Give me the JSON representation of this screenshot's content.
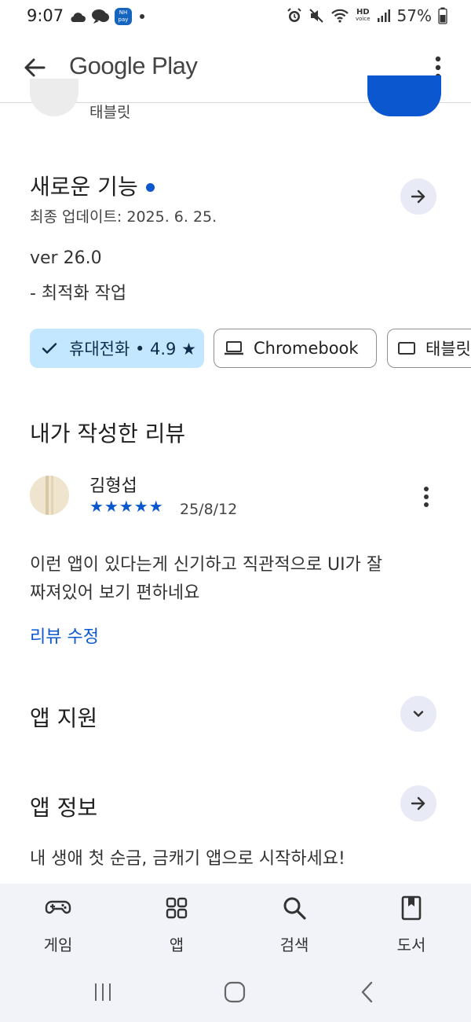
{
  "status_bar": {
    "time": "9:07",
    "left_icons": [
      "cloud-icon",
      "chat-bubble-icon",
      "nh-pay-icon",
      "dot-icon"
    ],
    "nh_pay_text": "NH pay",
    "right_icons": [
      "alarm-icon",
      "mute-icon",
      "wifi-icon",
      "hd-voice-icon",
      "signal-icon",
      "battery-icon"
    ],
    "hd_label": "HD",
    "voice_label": "voice",
    "battery": "57%"
  },
  "app_bar": {
    "title": "Google Play",
    "back_icon": "arrow-back-icon",
    "menu_icon": "more-vert-icon"
  },
  "partial_header": {
    "subtitle": "태블릿"
  },
  "whats_new": {
    "title": "새로운 기능",
    "last_updated": "최종 업데이트: 2025. 6. 25.",
    "version": "ver 26.0",
    "notes": "- 최적화 작업"
  },
  "device_chips": [
    {
      "label": "휴대전화 • 4.9 ★",
      "selected": true,
      "icon": "check-icon"
    },
    {
      "label": "Chromebook",
      "selected": false,
      "icon": "laptop-icon"
    },
    {
      "label": "태블릿",
      "selected": false,
      "icon": "tablet-icon"
    }
  ],
  "my_review": {
    "section_title": "내가 작성한 리뷰",
    "author": "김형섭",
    "rating": 5,
    "stars": "★★★★★",
    "date": "25/8/12",
    "text_line1": "이런 앱이 있다는게 신기하고 직관적으로 UI가 잘",
    "text_line2": "짜져있어 보기 편하네요",
    "edit_label": "리뷰 수정"
  },
  "app_support": {
    "title": "앱 지원"
  },
  "app_info": {
    "title": "앱 정보",
    "description": "내 생애 첫 순금, 금캐기 앱으로 시작하세요!"
  },
  "bottom_nav": {
    "items": [
      {
        "label": "게임",
        "icon": "gamepad-icon"
      },
      {
        "label": "앱",
        "icon": "apps-grid-icon"
      },
      {
        "label": "검색",
        "icon": "search-icon"
      },
      {
        "label": "도서",
        "icon": "book-icon"
      }
    ]
  },
  "system_nav": [
    "recent-apps-icon",
    "home-icon",
    "back-icon"
  ],
  "colors": {
    "accent": "#0b57d0",
    "chip_selected_bg": "#c2e7ff",
    "circle_button_bg": "#e8ebf6",
    "bottom_nav_bg": "#f1f3f8"
  }
}
